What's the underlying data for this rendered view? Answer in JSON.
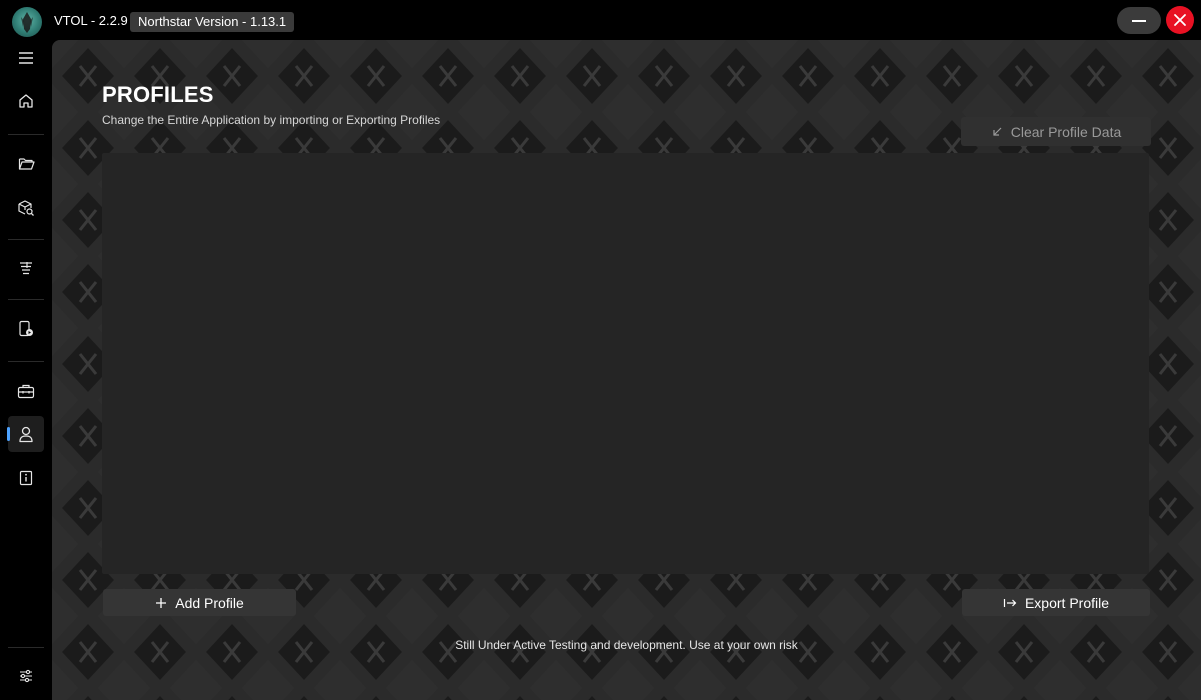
{
  "app": {
    "title": "VTOL - 2.2.9 |",
    "version_badge": "Northstar Version - 1.13.1"
  },
  "sidebar": {
    "items": [
      {
        "name": "menu",
        "icon": "hamburger-icon"
      },
      {
        "name": "home",
        "icon": "home-icon"
      },
      {
        "name": "folder",
        "icon": "folder-icon"
      },
      {
        "name": "mod-browser",
        "icon": "box-search-icon"
      },
      {
        "name": "skins",
        "icon": "filter-lines-icon"
      },
      {
        "name": "server-tools",
        "icon": "phone-play-icon"
      },
      {
        "name": "toolbox",
        "icon": "toolbox-icon"
      },
      {
        "name": "profiles",
        "icon": "user-icon",
        "active": true
      },
      {
        "name": "about",
        "icon": "info-icon"
      },
      {
        "name": "settings",
        "icon": "sliders-icon"
      }
    ]
  },
  "page": {
    "title": "PROFILES",
    "subtitle": "Change the Entire Application by importing or Exporting Profiles",
    "clear_button": "Clear Profile Data",
    "add_button": "Add Profile",
    "export_button": "Export Profile",
    "footer_note": "Still Under Active Testing and development. Use at your own risk"
  },
  "colors": {
    "accent": "#4ea3ff",
    "close": "#e81123",
    "panel": "#2b2b2b",
    "list": "#252525"
  }
}
